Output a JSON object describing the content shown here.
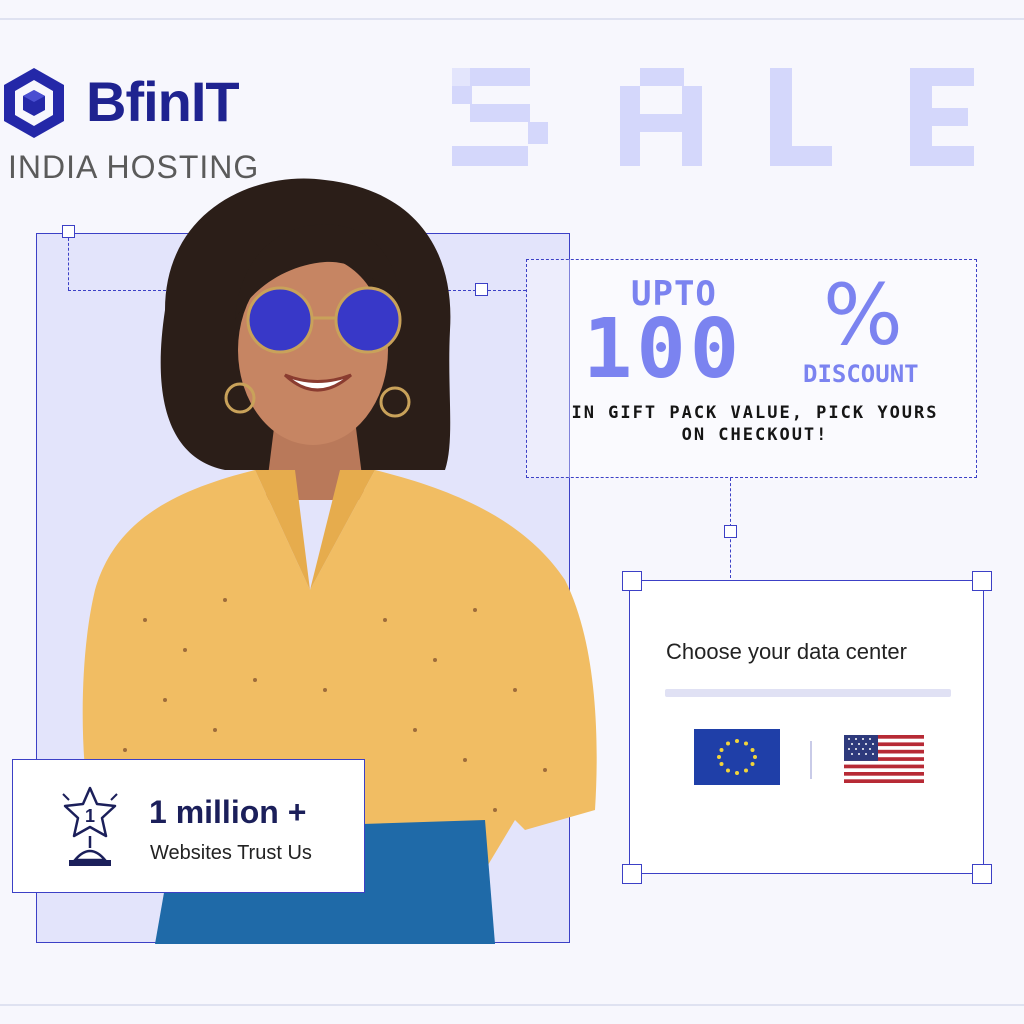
{
  "brand": {
    "name": "BfinIT",
    "subtitle": "INDIA HOSTING",
    "logo_icon": "bfinit-cube-logo",
    "color": "#1f2390"
  },
  "sale": {
    "word": "SALE",
    "color": "#d7d9fb"
  },
  "promo": {
    "upto": "UPTO",
    "amount": "100",
    "percent": "%",
    "discount": "DISCOUNT",
    "gift_text": "IN GIFT PACK VALUE, PICK YOURS ON CHECKOUT!",
    "accent_color": "#7b83f0"
  },
  "data_center": {
    "title": "Choose your data center",
    "options": [
      {
        "icon": "eu-flag-icon"
      },
      {
        "icon": "us-flag-icon"
      }
    ]
  },
  "trust": {
    "count": "1 million +",
    "text": "Websites Trust Us",
    "badge_number": "1",
    "icon": "trophy-icon"
  },
  "colors": {
    "frame": "#3c40c6",
    "frame_fill": "#e3e4fb",
    "background": "#f7f7fd"
  }
}
